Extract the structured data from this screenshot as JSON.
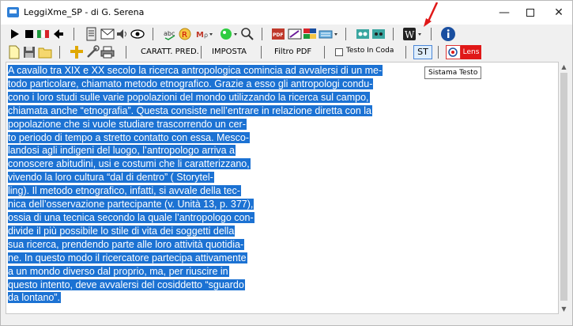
{
  "window": {
    "title": "LeggiXme_SP - di G. Serena",
    "controls": {
      "minimize": "—",
      "close": "✕"
    }
  },
  "toolbar2": {
    "caratt_pred_label": "CARATT. PRED.",
    "imposta_label": "IMPOSTA",
    "filtro_pdf_label": "Filtro PDF",
    "testo_in_coda_label": "Testo In Coda",
    "st_label": "ST",
    "lens_label": "Lens"
  },
  "tooltip": {
    "text": "Sistama Testo"
  },
  "editor": {
    "lines": [
      "A cavallo tra XIX e XX secolo la ricerca antropologica comincia ad avvalersi di un me-",
      "todo particolare, chiamato metodo etnografico. Grazie a esso gli antropologi condu-",
      "cono i loro studi sulle varie popolazioni del mondo utilizzando la ricerca sul campo,",
      "chiamata anche “etnografia”. Questa consiste nell’entrare in relazione diretta con la",
      "popolazione che si vuole studiare trascorrendo un cer-",
      "to periodo di tempo a stretto contatto con essa. Mesco-",
      "landosi agli indigeni del luogo, l’antropologo arriva a",
      "conoscere abitudini, usi e costumi che li caratterizzano,",
      "vivendo la loro cultura “dal di dentro” ( Storytel-",
      "ling). Il metodo etnografico, infatti, si avvale della tec-",
      "nica dell’osservazione partecipante (v. Unità 13, p. 377),",
      "ossia di una tecnica secondo la quale l’antropologo con-",
      "divide il più possibile lo stile di vita dei soggetti della",
      "sua ricerca, prendendo parte alle loro attività quotidia-",
      "ne. In questo modo il ricercatore partecipa attivamente",
      "a un mondo diverso dal proprio, ma, per riuscire in",
      "questo intento, deve avvalersi del cosiddetto “sguardo",
      "da lontano”."
    ]
  },
  "colors": {
    "selection": "#1c72d3",
    "arrow": "#e01818",
    "lens": "#e01818"
  },
  "icons": [
    "play-icon",
    "stop-icon",
    "italian-flag-icon",
    "back-icon",
    "document-icon",
    "envelope-icon",
    "speaker-icon",
    "eye-icon",
    "spellcheck-icon",
    "registered-icon",
    "mp-icon",
    "translate-icon",
    "search-icon",
    "pdf-icon",
    "pen-icon",
    "flags-icon",
    "keyboard-icon",
    "eyes-icon",
    "eyes-alt-icon",
    "word-icon",
    "info-icon",
    "new-file-icon",
    "save-icon",
    "open-folder-icon",
    "cross-icon",
    "tools-icon",
    "printer-icon"
  ]
}
